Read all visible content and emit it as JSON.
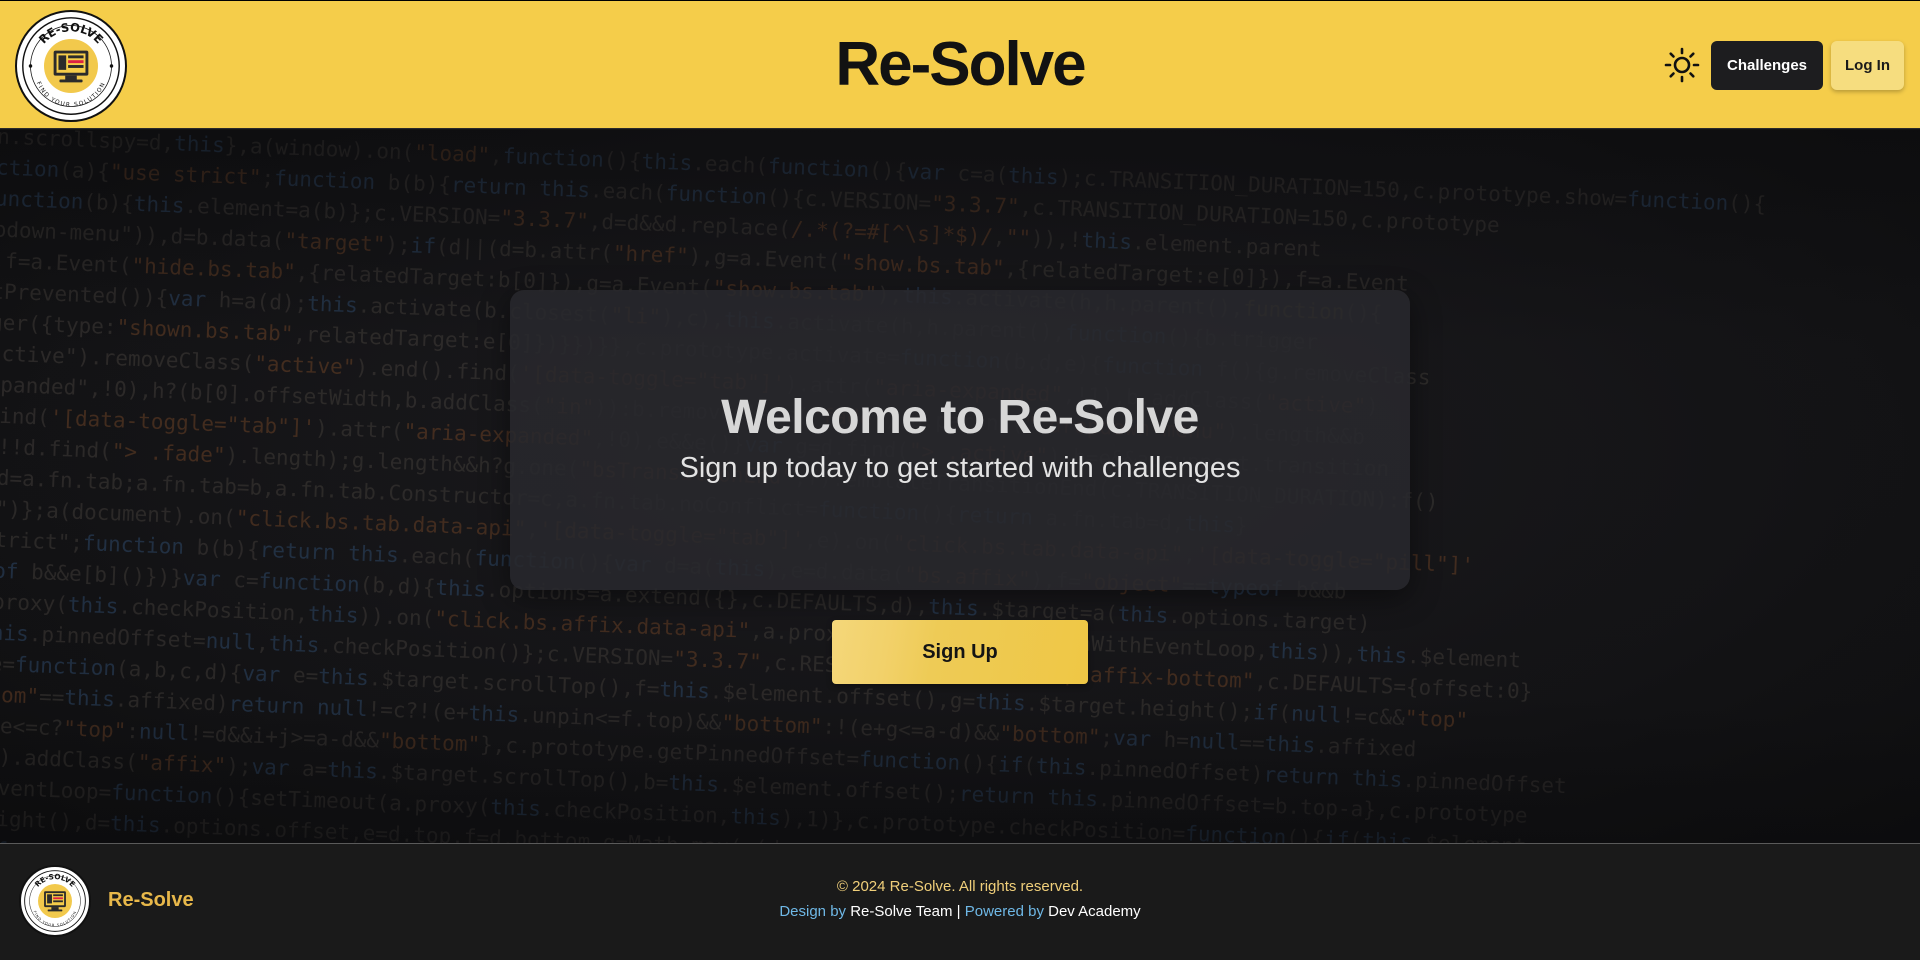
{
  "header": {
    "site_title": "Re-Solve",
    "logo_text_top": "RE-SOLVE",
    "logo_text_bottom": "FIND YOUR SOLUTION",
    "theme_toggle_icon": "sun-icon",
    "nav_challenges": "Challenges",
    "nav_login": "Log In"
  },
  "hero": {
    "title": "Welcome to Re-Solve",
    "subtitle": "Sign up today to get started with challenges",
    "signup_label": "Sign Up",
    "background": "code-listing-image"
  },
  "footer": {
    "brand": "Re-Solve",
    "copyright": "© 2024 Re-Solve. All rights reserved.",
    "design_label": "Design by",
    "design_team": "Re-Solve Team",
    "separator": "|",
    "powered_label": "Powered by",
    "powered_by": "Dev Academy"
  },
  "colors": {
    "header_bg": "#f5cd4a",
    "primary_dark": "#1d1d1f",
    "accent_gold": "#efc745",
    "footer_bg": "#1a1a1a",
    "footer_brand": "#e8b84a",
    "credit_label": "#6fb8e6"
  }
}
